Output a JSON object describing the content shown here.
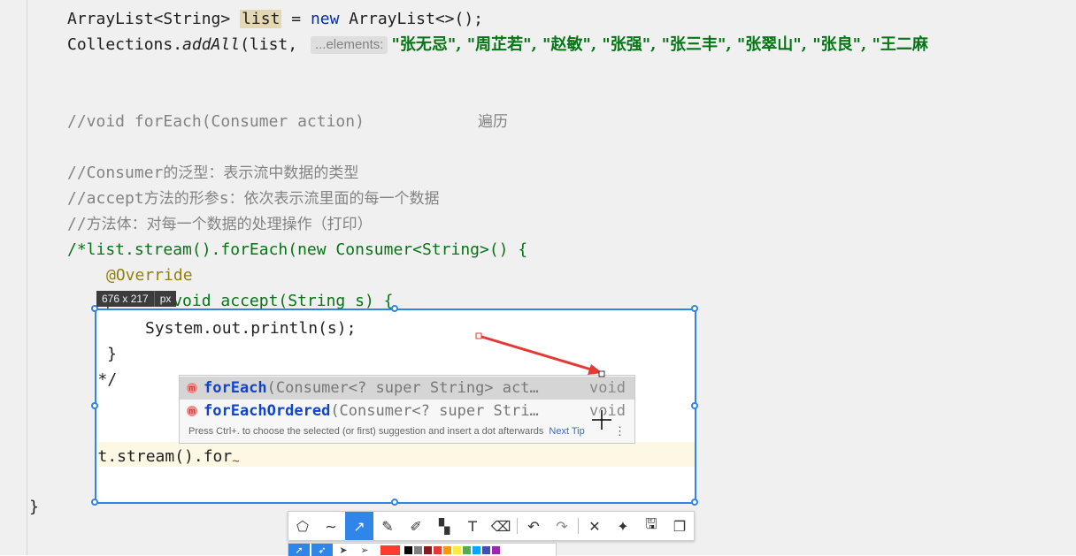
{
  "code": {
    "line1_type": "ArrayList<String> ",
    "line1_var": "list",
    "line1_eq": " = ",
    "line1_new": "new",
    "line1_rest": " ArrayList<>();",
    "line2_prefix": "Collections.",
    "line2_method": "addAll",
    "line2_args": "(list, ",
    "line2_hint": "...elements:",
    "line2_strings": "\"张无忌\", \"周芷若\", \"赵敏\", \"张强\", \"张三丰\", \"张翠山\", \"张良\", \"王二麻",
    "comment_foreach_code": "//void forEach(Consumer action)",
    "comment_foreach_cn": "遍历",
    "comment_consumer_a": "//Consumer",
    "comment_consumer_b": "的泛型：表示流中数据的类型",
    "comment_accept_a": "//accept",
    "comment_accept_b": "方法的形参",
    "comment_accept_c": "s",
    "comment_accept_d": "：依次表示流里面的每一个数据",
    "comment_body_a": "//",
    "comment_body_b": "方法体：对每一个数据的处理操作（打印）",
    "block_open": "/*list.stream().forEach(new Consumer<String>() {",
    "override": "@Override",
    "accept_line": "    public void accept(String s) {",
    "println_line": "System.out.println(s);",
    "close_inner": "}",
    "close_block": "});*/",
    "typing_line": "list.stream().for",
    "close_class": "}"
  },
  "capture": {
    "dimension": "676 x 217",
    "unit": "px"
  },
  "autocomplete": {
    "items": [
      {
        "match": "for",
        "rest": "Each",
        "params": "(Consumer<? super String> act…",
        "type": "void"
      },
      {
        "match": "for",
        "rest": "EachOrdered",
        "params": "(Consumer<? super Stri…",
        "type": "void"
      }
    ],
    "footer": "Press Ctrl+. to choose the selected (or first) suggestion and insert a dot afterwards",
    "tip": "Next Tip"
  },
  "toolbar": {
    "tools": [
      {
        "name": "shape-tool",
        "icon": "shape-icon",
        "glyph": "⬠"
      },
      {
        "name": "curve-tool",
        "icon": "curve-icon",
        "glyph": "∼"
      },
      {
        "name": "arrow-tool",
        "icon": "arrow-icon",
        "glyph": "↗"
      },
      {
        "name": "pen-tool",
        "icon": "pencil-icon",
        "glyph": "✎"
      },
      {
        "name": "marker-tool",
        "icon": "marker-icon",
        "glyph": "✐"
      },
      {
        "name": "mosaic-tool",
        "icon": "mosaic-icon",
        "glyph": "▚"
      },
      {
        "name": "text-tool",
        "icon": "text-icon",
        "glyph": "T"
      },
      {
        "name": "eraser-tool",
        "icon": "eraser-icon",
        "glyph": "⌫"
      },
      {
        "name": "undo-button",
        "icon": "undo-icon",
        "glyph": "↶"
      },
      {
        "name": "redo-button",
        "icon": "redo-icon",
        "glyph": "↷"
      },
      {
        "name": "cancel-button",
        "icon": "close-icon",
        "glyph": "✕"
      },
      {
        "name": "pin-button",
        "icon": "pin-icon",
        "glyph": "✦"
      },
      {
        "name": "save-button",
        "icon": "save-icon",
        "glyph": "🖫"
      },
      {
        "name": "copy-button",
        "icon": "copy-icon",
        "glyph": "❐"
      }
    ],
    "colors": {
      "selected": "#ff3b30",
      "palette": [
        "#000000",
        "#808080",
        "#8b1a1a",
        "#e53935",
        "#ff9800",
        "#ffeb3b",
        "#4caf50",
        "#03a9f4",
        "#3f51b5",
        "#9c27b0"
      ]
    },
    "accent": "#2f86e8",
    "arrow_color": "#e53935"
  }
}
